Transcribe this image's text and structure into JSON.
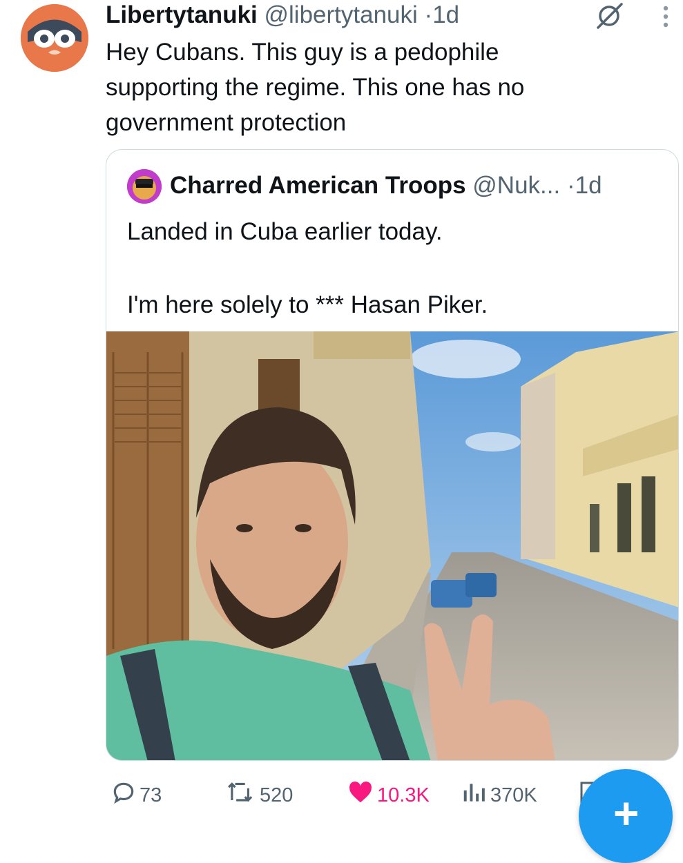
{
  "tweet": {
    "author_name": "Libertytanuki",
    "author_handle": "@libertytanuki",
    "separator": "·",
    "time": "1d",
    "text": "Hey Cubans. This guy is a pedophile\nsupporting the regime. This one has no\ngovernment protection"
  },
  "quoted_tweet": {
    "author_name": "Charred American Troops",
    "author_handle": "@Nuk...",
    "separator": "·",
    "time": "1d",
    "text": "Landed in Cuba earlier today.\n\nI'm here solely to *** Hasan Piker."
  },
  "actions": {
    "replies": "73",
    "reposts": "520",
    "likes": "10.3K",
    "views": "370K"
  },
  "icons": {
    "more": "more-vertical-icon",
    "grok": "grok-icon",
    "reply": "reply-icon",
    "repost": "repost-icon",
    "like": "heart-icon",
    "views": "views-icon",
    "compose": "plus-icon"
  },
  "colors": {
    "like_active": "#f91880",
    "fab": "#1d9bf0",
    "secondary_text": "#536471",
    "border": "#cfd9de"
  }
}
